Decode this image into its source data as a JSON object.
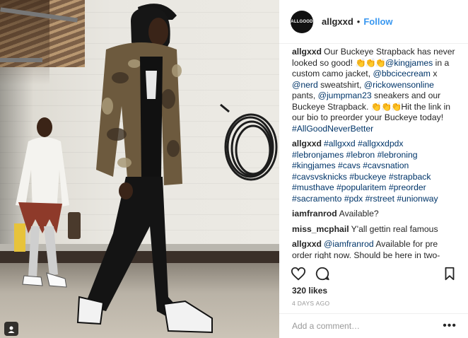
{
  "post": {
    "author": "allgxxd",
    "avatar_text": "ALLGOOD",
    "separator": "•",
    "follow_label": "Follow",
    "comments": [
      {
        "user": "allgxxd",
        "parts": [
          {
            "type": "text",
            "value": "Our Buckeye Strapback has never looked so good! "
          },
          {
            "type": "emoji",
            "value": "👏👏👏"
          },
          {
            "type": "tag",
            "value": "@kingjames"
          },
          {
            "type": "text",
            "value": " in a custom camo jacket, "
          },
          {
            "type": "tag",
            "value": "@bbcicecream"
          },
          {
            "type": "text",
            "value": " x "
          },
          {
            "type": "tag",
            "value": "@nerd"
          },
          {
            "type": "text",
            "value": " sweatshirt, "
          },
          {
            "type": "tag",
            "value": "@rickowensonline"
          },
          {
            "type": "text",
            "value": " pants, "
          },
          {
            "type": "tag",
            "value": "@jumpman23"
          },
          {
            "type": "text",
            "value": " sneakers and our Buckeye Strapback. "
          },
          {
            "type": "emoji",
            "value": "👏👏👏"
          },
          {
            "type": "text",
            "value": "Hit the link in our bio to preorder your Buckeye today! "
          },
          {
            "type": "tag",
            "value": "#AllGoodNeverBetter"
          }
        ]
      },
      {
        "user": "allgxxd",
        "parts": [
          {
            "type": "tag",
            "value": "#allgxxd #allgxxdpdx #lebronjames #lebron #lebroning #kingjames #cavs #cavsnation #cavsvsknicks #buckeye #strapback #musthave #popularitem #preorder #sacramento #pdx #rstreet #unionway"
          }
        ]
      },
      {
        "user": "iamfranrod",
        "parts": [
          {
            "type": "text",
            "value": "Available?"
          }
        ]
      },
      {
        "user": "miss_mcphail",
        "parts": [
          {
            "type": "text",
            "value": "Y'all gettin real famous"
          }
        ]
      },
      {
        "user": "allgxxd",
        "parts": [
          {
            "type": "tag",
            "value": "@iamfranrod"
          },
          {
            "type": "text",
            "value": " Available for pre order right now. Should be here in two-three weeks!"
          }
        ]
      }
    ],
    "likes": "320 likes",
    "timestamp": "4 DAYS AGO",
    "add_comment_placeholder": "Add a comment…",
    "more_label": "•••",
    "icons": {
      "like": "heart-icon",
      "comment": "comment-icon",
      "save": "bookmark-icon",
      "tagged": "person-tag-icon"
    }
  },
  "colors": {
    "link": "#003569",
    "follow": "#3897f0",
    "text": "#262626",
    "muted": "#999999"
  }
}
